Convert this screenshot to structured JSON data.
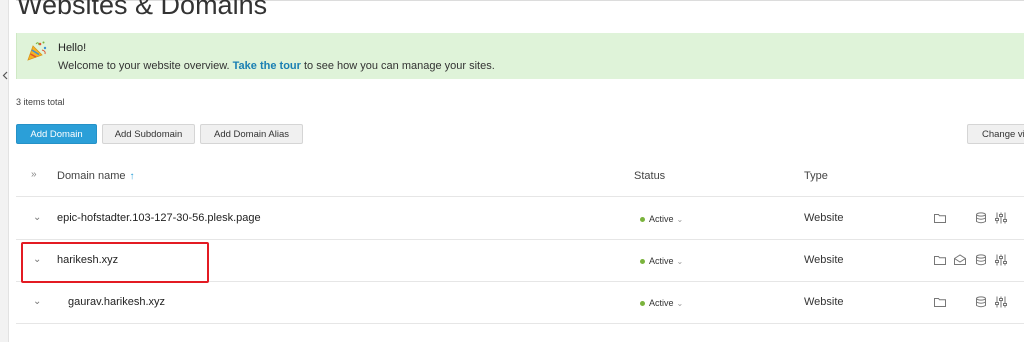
{
  "page": {
    "title": "Websites & Domains"
  },
  "banner": {
    "hello": "Hello!",
    "text_before": "Welcome to your website overview.",
    "link": "Take the tour",
    "text_after": "to see how you can manage your sites.",
    "icon": "party-popper-icon"
  },
  "list": {
    "items_total": "3 items total"
  },
  "toolbar": {
    "add_domain": "Add Domain",
    "add_subdomain": "Add Subdomain",
    "add_domain_alias": "Add Domain Alias",
    "change_view": "Change vi"
  },
  "table": {
    "columns": {
      "domain_name": "Domain name",
      "status": "Status",
      "type": "Type"
    },
    "sort_indicator": "↑",
    "rows": [
      {
        "domain": "epic-hofstadter.103-127-30-56.plesk.page",
        "status": "Active",
        "type": "Website",
        "icons": [
          "folder-icon",
          "database-icon",
          "settings-sliders-icon"
        ]
      },
      {
        "domain": "harikesh.xyz",
        "status": "Active",
        "type": "Website",
        "icons": [
          "folder-icon",
          "mail-icon",
          "database-icon",
          "settings-sliders-icon"
        ]
      },
      {
        "domain": "gaurav.harikesh.xyz",
        "status": "Active",
        "type": "Website",
        "icons": [
          "folder-icon",
          "database-icon",
          "settings-sliders-icon"
        ]
      }
    ]
  },
  "colors": {
    "accent": "#2b9fd8",
    "banner_bg": "#dff3d9",
    "status_active": "#7ab33c",
    "highlight": "#e31b23"
  }
}
